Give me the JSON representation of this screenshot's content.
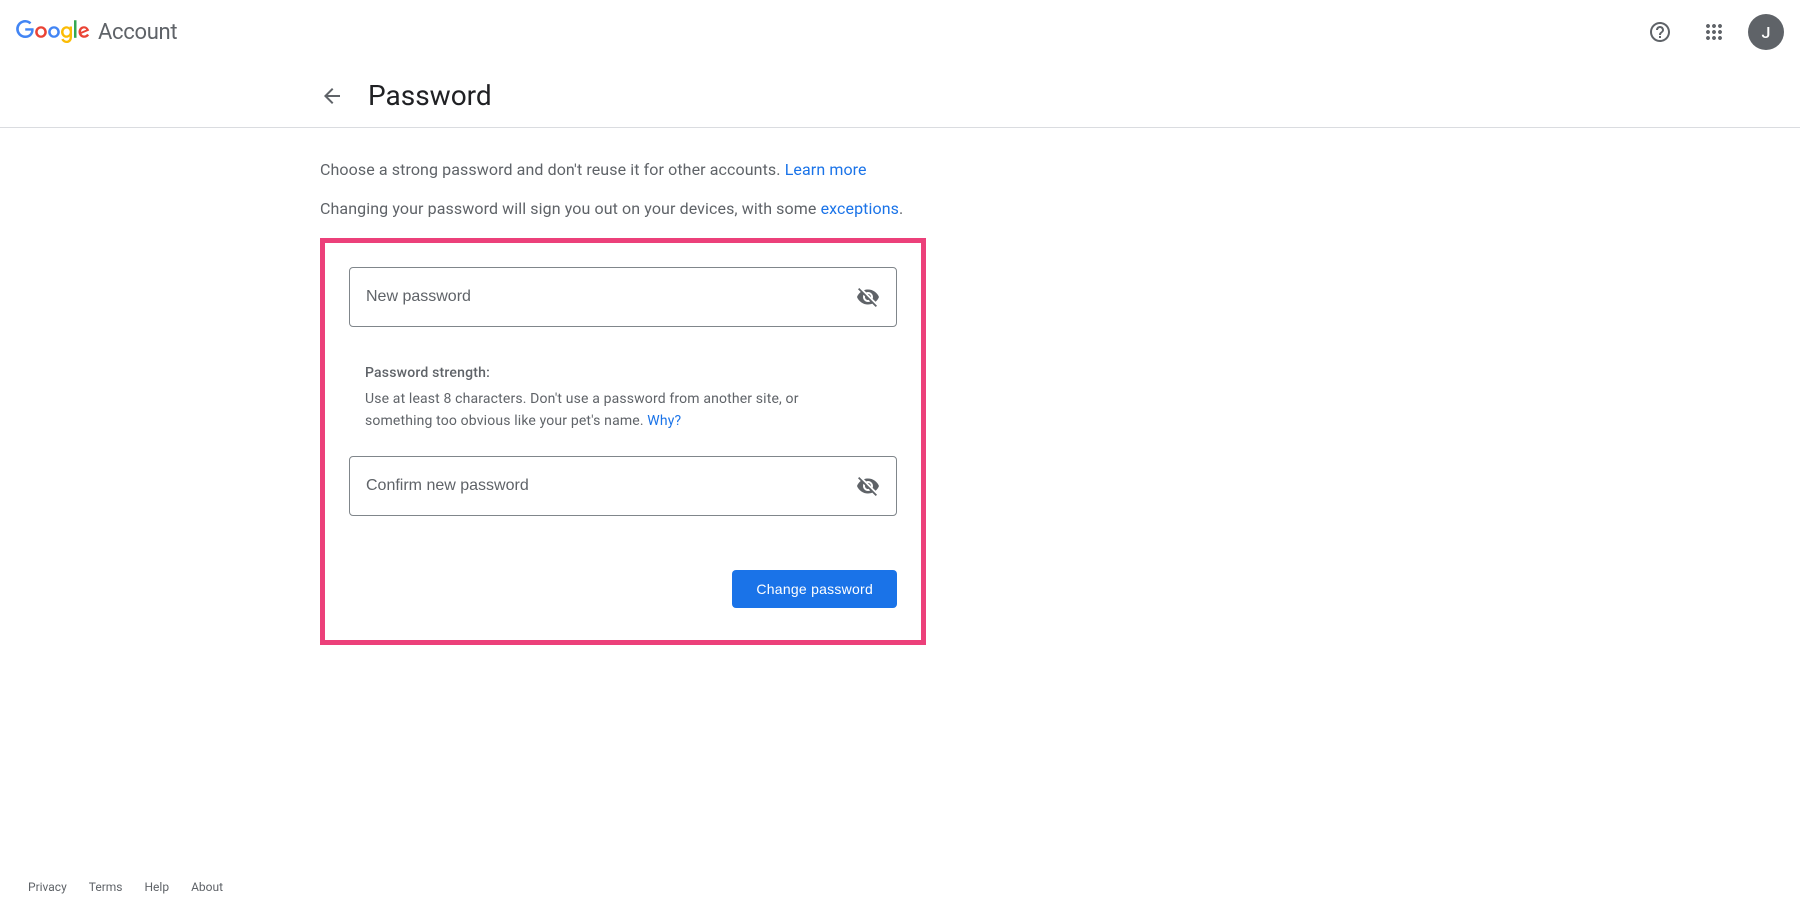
{
  "header": {
    "brand_suffix": "Account",
    "avatar_initial": "J"
  },
  "page": {
    "title": "Password"
  },
  "intro": {
    "line1_text": "Choose a strong password and don't reuse it for other accounts. ",
    "line1_link": "Learn more",
    "line2_text": "Changing your password will sign you out on your devices, with some ",
    "line2_link": "exceptions",
    "line2_suffix": "."
  },
  "form": {
    "new_password_placeholder": "New password",
    "confirm_password_placeholder": "Confirm new password",
    "strength_label": "Password strength:",
    "strength_text": "Use at least 8 characters. Don't use a password from another site, or something too obvious like your pet's name. ",
    "strength_link": "Why?",
    "submit_label": "Change password"
  },
  "footer": {
    "privacy": "Privacy",
    "terms": "Terms",
    "help": "Help",
    "about": "About"
  }
}
